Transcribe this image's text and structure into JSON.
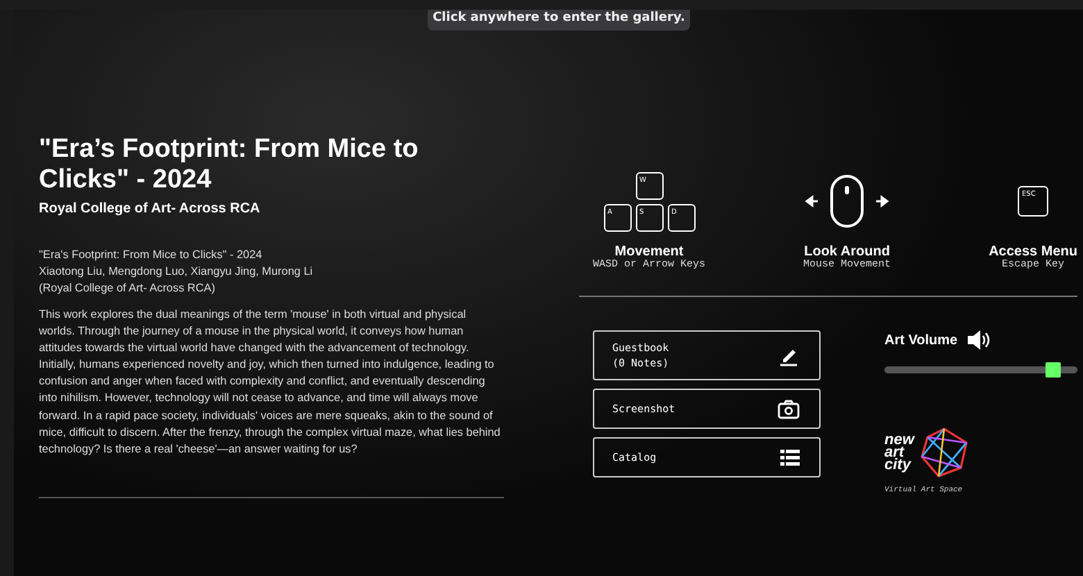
{
  "banner": "Click anywhere to enter the gallery.",
  "title": "\"Era’s Footprint: From Mice to Clicks\" - 2024",
  "subtitle": "Royal College of Art- Across RCA",
  "credits": [
    "\"Era's Footprint: From Mice to Clicks\" - 2024",
    "Xiaotong Liu, Mengdong Luo, Xiangyu Jing, Murong Li",
    "(Royal College of Art- Across RCA)"
  ],
  "description": "This work explores the dual meanings of the term 'mouse' in both virtual and physical worlds. Through the journey of a mouse in the physical world, it conveys how human attitudes towards the virtual world have changed with the advancement of technology. Initially, humans experienced novelty and joy, which then turned into indulgence, leading to confusion and anger when faced with complexity and conflict, and eventually descending into nihilism. However, technology will not cease to advance, and time will always move forward. In a rapid pace society, individuals' voices are mere squeaks, akin to the sound of mice, difficult to discern. After the frenzy, through the complex virtual maze, what lies behind technology? Is there a real 'cheese'—an answer waiting for us?",
  "controls": [
    {
      "kind": "keys",
      "keys": [
        "W",
        "A",
        "S",
        "D"
      ],
      "label": "Movement",
      "hint": "WASD or Arrow Keys"
    },
    {
      "kind": "mouse",
      "label": "Look Around",
      "hint": "Mouse Movement"
    },
    {
      "kind": "esc",
      "keys": [
        "ESC"
      ],
      "label": "Access Menu",
      "hint": "Escape Key"
    }
  ],
  "actions": [
    {
      "kind": "guestbook",
      "lines": [
        "Guestbook",
        "(0 Notes)"
      ]
    },
    {
      "kind": "screenshot",
      "lines": [
        "Screenshot"
      ]
    },
    {
      "kind": "catalog",
      "lines": [
        "Catalog"
      ]
    }
  ],
  "volume": {
    "label": "Art Volume",
    "level": 0.88
  },
  "logo": {
    "words": [
      "new",
      "art",
      "city"
    ],
    "tagline": "Virtual Art Space"
  }
}
